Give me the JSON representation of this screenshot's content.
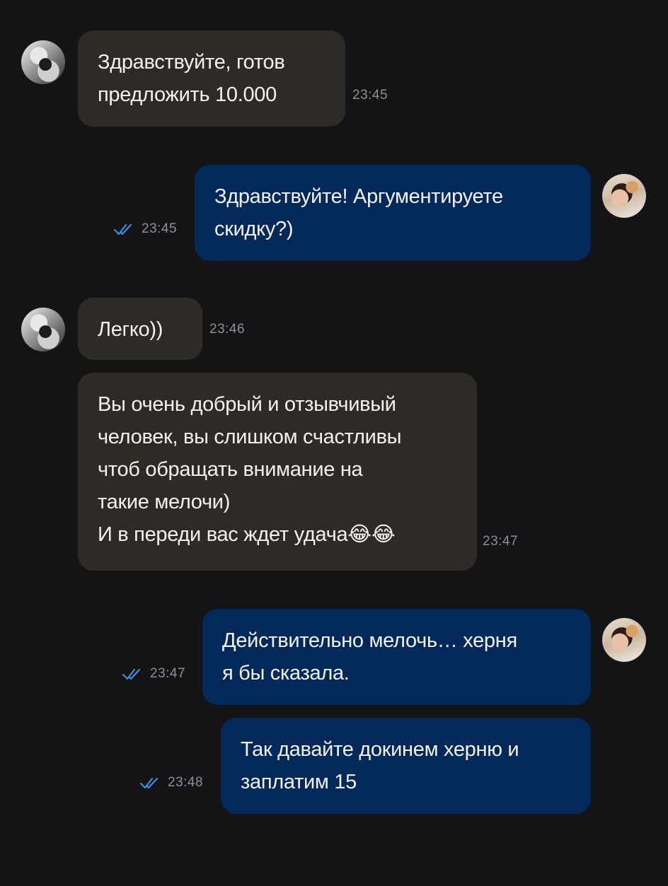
{
  "chat": {
    "messages": [
      {
        "direction": "incoming",
        "text": "Здравствуйте, готов\nпредложить 10.000",
        "time": "23:45"
      },
      {
        "direction": "outgoing",
        "text": "Здравствуйте! Аргументируете\nскидку?)",
        "time": "23:45",
        "status": "read"
      },
      {
        "direction": "incoming",
        "text": "Легко))",
        "time": "23:46"
      },
      {
        "direction": "incoming",
        "text": "Вы очень добрый и отзывчивый\nчеловек, вы слишком счастливы\nчтоб обращать внимание на\nтакие мелочи)\nИ в переди вас ждет удача😂😂",
        "time": "23:47"
      },
      {
        "direction": "outgoing",
        "text": "Действительно мелочь… херня\nя бы сказала.",
        "time": "23:47",
        "status": "read"
      },
      {
        "direction": "outgoing",
        "text": "Так давайте докинем херню и\nзаплатим 15",
        "time": "23:48",
        "status": "read"
      }
    ]
  },
  "icons": {
    "read_receipt": "double-check-icon",
    "avatar_incoming": "contact-avatar",
    "avatar_outgoing": "user-avatar"
  },
  "colors": {
    "background": "#141417",
    "incoming_bubble": "#2e2a25",
    "outgoing_bubble": "#03295a",
    "timestamp": "#8f8f94",
    "read_check": "#3d8fe0"
  }
}
